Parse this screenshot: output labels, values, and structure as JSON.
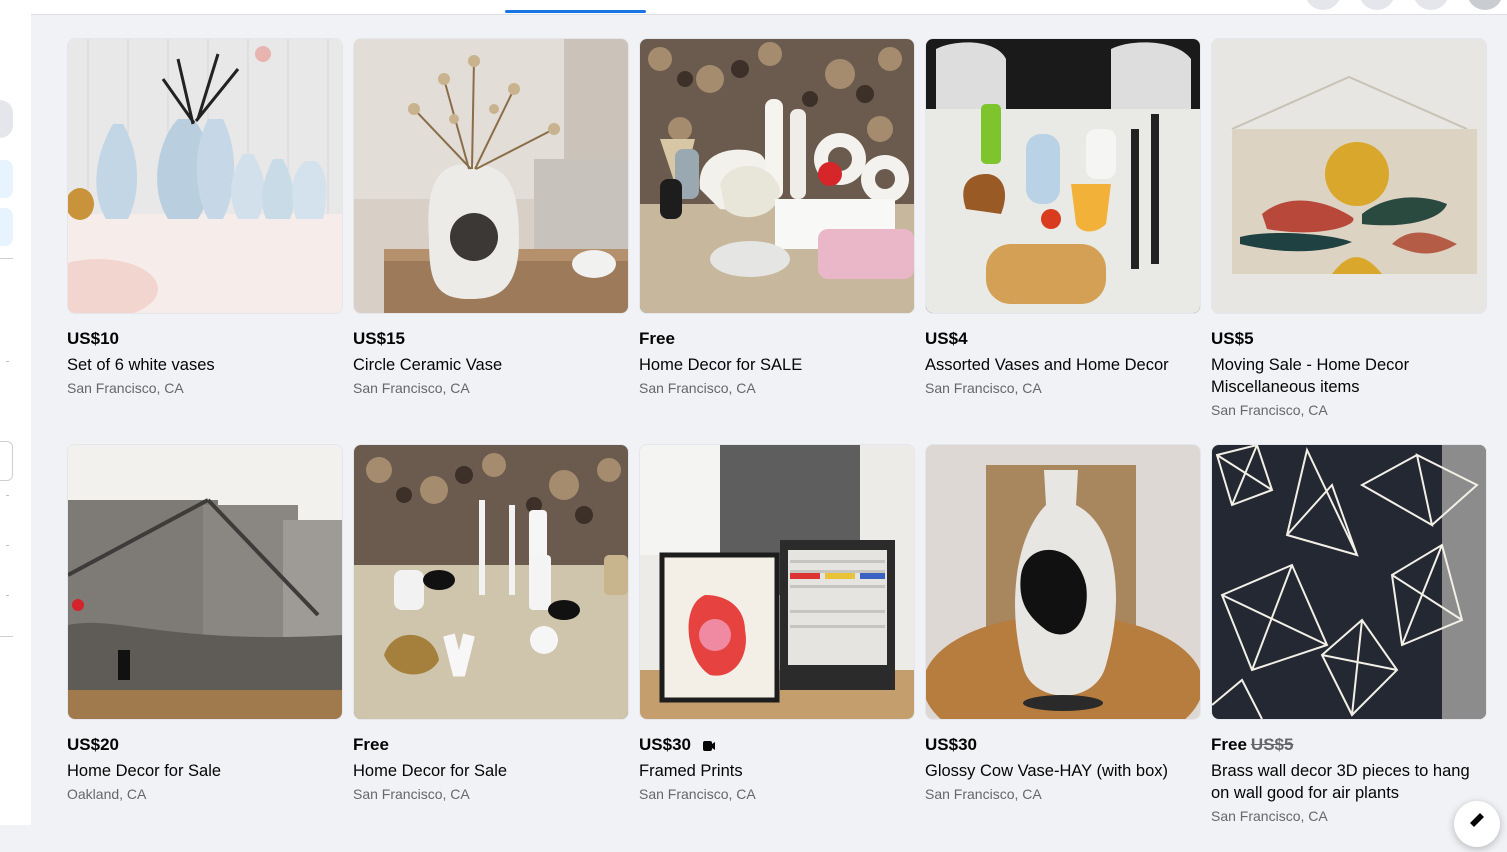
{
  "listings": [
    {
      "price": "US$10",
      "title": "Set of 6 white vases",
      "location": "San Francisco, CA"
    },
    {
      "price": "US$15",
      "title": "Circle Ceramic Vase",
      "location": "San Francisco, CA"
    },
    {
      "price": "Free",
      "title": "Home Decor for SALE",
      "location": "San Francisco, CA"
    },
    {
      "price": "US$4",
      "title": "Assorted Vases and Home Decor",
      "location": "San Francisco, CA"
    },
    {
      "price": "US$5",
      "title": "Moving Sale - Home Decor Miscellaneous items",
      "location": "San Francisco, CA"
    },
    {
      "price": "US$20",
      "title": "Home Decor for Sale",
      "location": "Oakland, CA"
    },
    {
      "price": "Free",
      "title": "Home Decor for Sale",
      "location": "San Francisco, CA"
    },
    {
      "price": "US$30",
      "title": "Framed Prints",
      "location": "San Francisco, CA",
      "badge": "video-icon"
    },
    {
      "price": "US$30",
      "title": "Glossy Cow Vase-HAY (with box)",
      "location": "San Francisco, CA"
    },
    {
      "price": "Free",
      "old_price": "US$5",
      "title": "Brass wall decor 3D pieces to hang on wall good for air plants",
      "location": "San Francisco, CA"
    }
  ],
  "colors": {
    "accent": "#1b74e4",
    "secondary_text": "#65676b",
    "background": "#f0f2f5"
  }
}
